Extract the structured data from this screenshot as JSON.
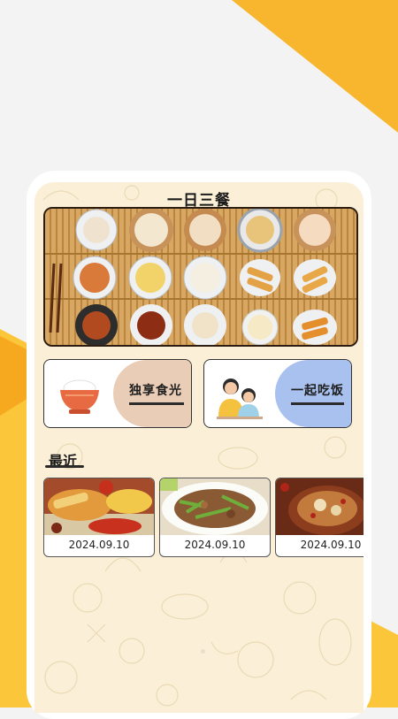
{
  "colors": {
    "accent_yellow": "#f8b62f",
    "screen_bg": "#fbf0d7",
    "solo_panel": "#e9cdb7",
    "together_panel": "#a8c1ee",
    "banner_frame": "#2c1d10"
  },
  "header": {
    "title": "一日三餐"
  },
  "banner": {
    "image": "bamboo-mat-dishes"
  },
  "cards": [
    {
      "label": "独享食光",
      "icon": "rice-bowl-icon"
    },
    {
      "label": "一起吃饭",
      "icon": "family-icon"
    }
  ],
  "recent": {
    "title": "最近",
    "items": [
      {
        "date": "2024.09.10",
        "image": "chinese-feast-photo"
      },
      {
        "date": "2024.09.10",
        "image": "stir-fried-meat-photo"
      },
      {
        "date": "2024.09.10",
        "image": "soup-pot-photo"
      }
    ]
  }
}
